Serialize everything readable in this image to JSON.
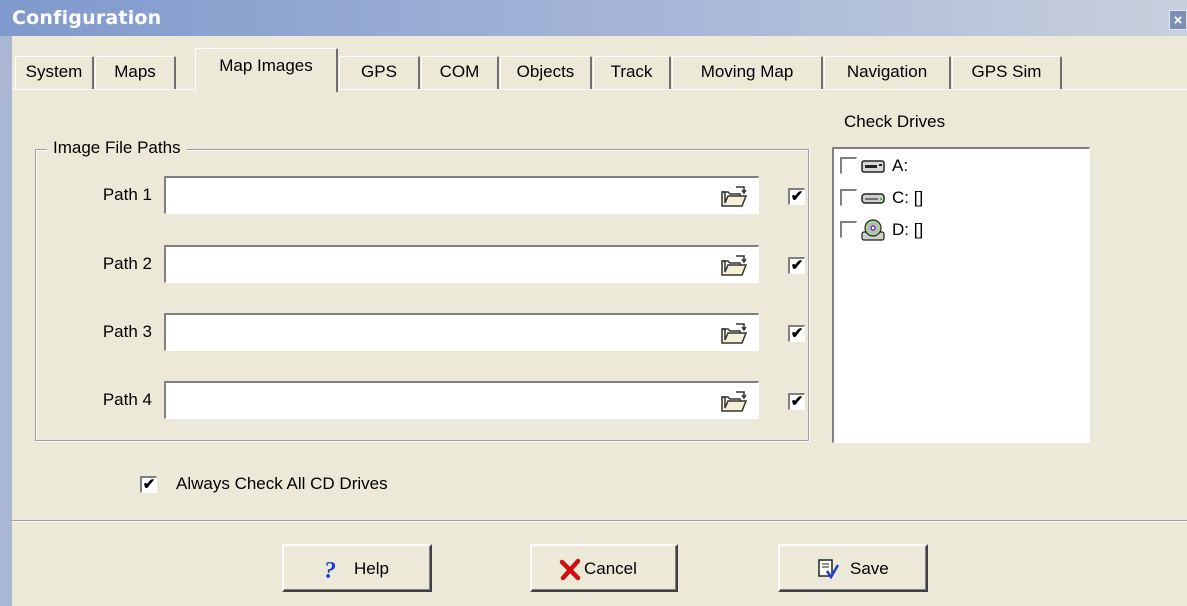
{
  "window": {
    "title": "Configuration",
    "close_label": "×"
  },
  "tabs": [
    {
      "label": "System"
    },
    {
      "label": "Maps"
    },
    {
      "label": "Map Images"
    },
    {
      "label": "GPS"
    },
    {
      "label": "COM"
    },
    {
      "label": "Objects"
    },
    {
      "label": "Track"
    },
    {
      "label": "Moving Map"
    },
    {
      "label": "Navigation"
    },
    {
      "label": "GPS Sim"
    }
  ],
  "active_tab": "Map Images",
  "image_paths": {
    "group_title": "Image File Paths",
    "rows": [
      {
        "label": "Path 1",
        "value": "",
        "checked": true
      },
      {
        "label": "Path 2",
        "value": "",
        "checked": true
      },
      {
        "label": "Path 3",
        "value": "",
        "checked": true
      },
      {
        "label": "Path 4",
        "value": "",
        "checked": true
      }
    ]
  },
  "check_drives": {
    "label": "Check Drives",
    "items": [
      {
        "label": "A:",
        "checked": false,
        "icon": "floppy-drive-icon"
      },
      {
        "label": "C: []",
        "checked": false,
        "icon": "hard-drive-icon"
      },
      {
        "label": "D: []",
        "checked": false,
        "icon": "cd-drive-icon"
      }
    ]
  },
  "always_check_cd": {
    "label": "Always Check All CD Drives",
    "checked": true
  },
  "buttons": {
    "help": "Help",
    "cancel": "Cancel",
    "save": "Save"
  },
  "check_mark": "✔",
  "colors": {
    "titlebar": "#7f99cc",
    "face": "#ece9d8",
    "help_icon": "#1a3fd6",
    "cancel_icon": "#d01010"
  }
}
